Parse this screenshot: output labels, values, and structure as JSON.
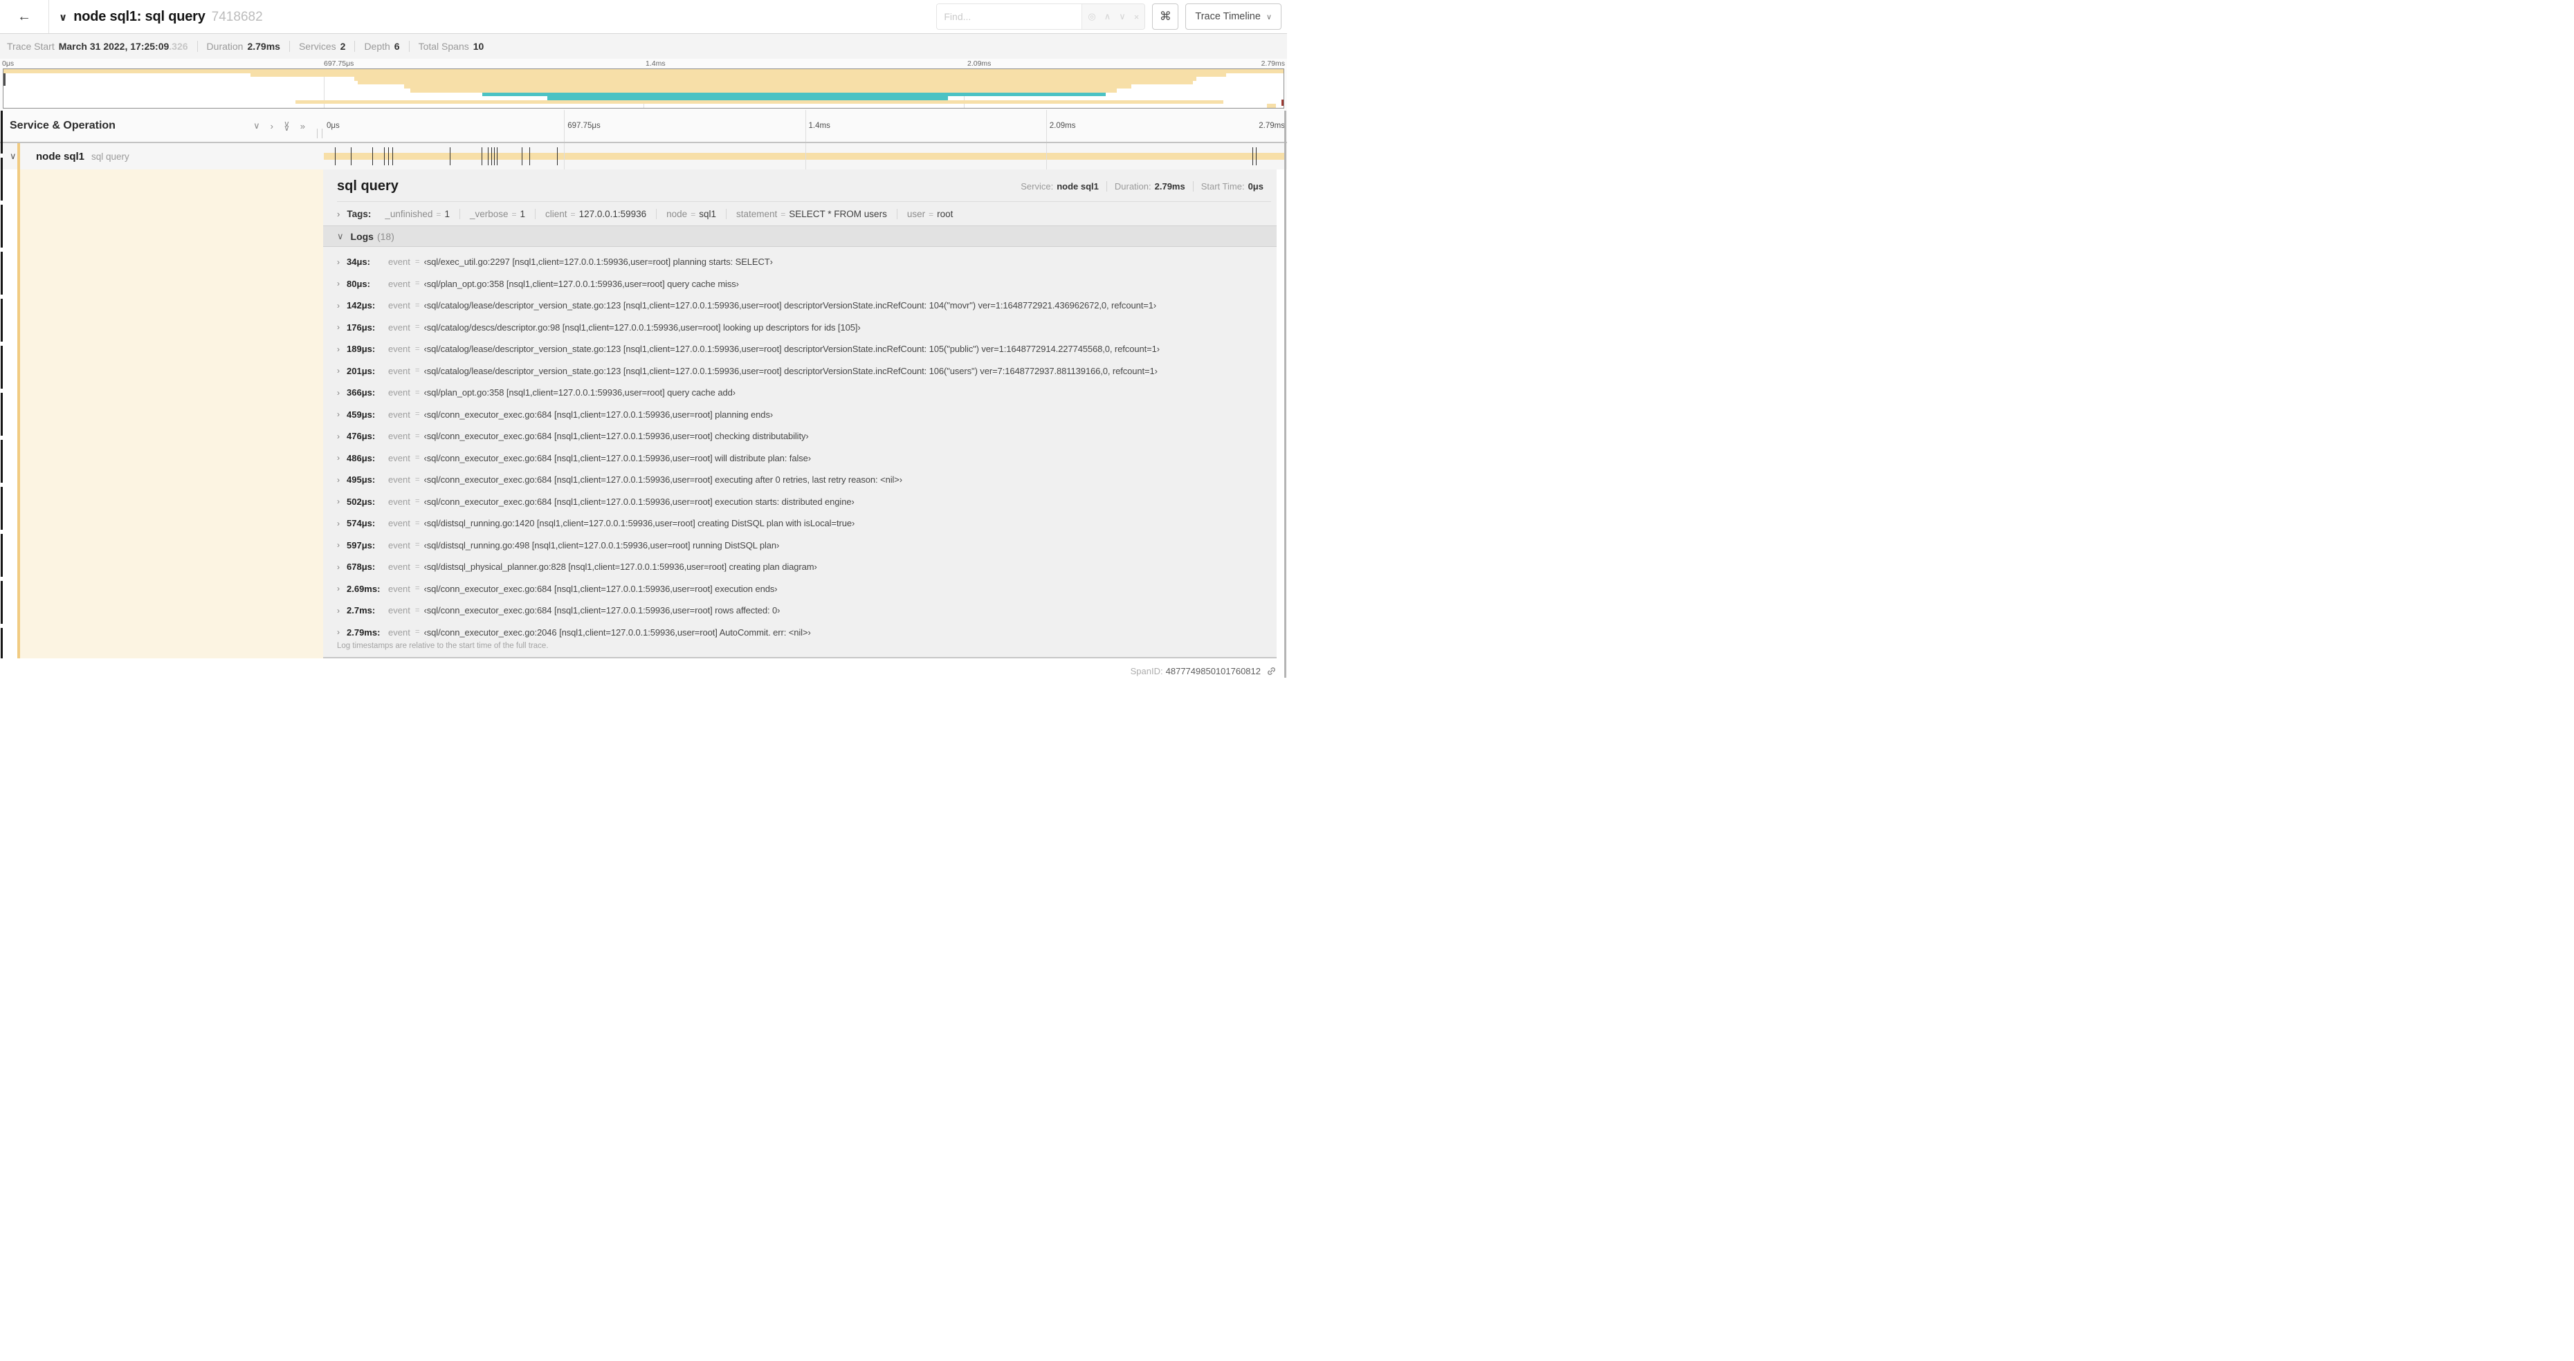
{
  "icons": {
    "back": "←",
    "chevron_down": "∨",
    "chevron_up": "∧",
    "chevron_right": "›",
    "double_chevron_right": "»",
    "close": "×",
    "command": "⌘",
    "crosshair": "◎"
  },
  "header": {
    "title": "node sql1: sql query",
    "trace_id": "7418682",
    "find_placeholder": "Find...",
    "view_dropdown_label": "Trace Timeline"
  },
  "trace_info": [
    {
      "label": "Trace Start",
      "value": "March 31 2022, 17:25:09",
      "suffix": ".326"
    },
    {
      "label": "Duration",
      "value": "2.79ms"
    },
    {
      "label": "Services",
      "value": "2"
    },
    {
      "label": "Depth",
      "value": "6"
    },
    {
      "label": "Total Spans",
      "value": "10"
    }
  ],
  "ruler": {
    "ticks": [
      {
        "label": "0μs",
        "pct": 0
      },
      {
        "label": "697.75μs",
        "pct": 25
      },
      {
        "label": "1.4ms",
        "pct": 50
      },
      {
        "label": "2.09ms",
        "pct": 75
      },
      {
        "label": "2.79ms",
        "pct": 100
      }
    ],
    "gridlines": [
      25,
      50,
      75
    ]
  },
  "colors": {
    "tan": "#f7dfa8",
    "cyan": "#4bc2c4",
    "stripe": "#f1cb82",
    "cream": "#fcf4e2"
  },
  "minimap": {
    "bars": [
      {
        "row": 0,
        "start": 0,
        "end": 100,
        "color": "tan"
      },
      {
        "row": 1,
        "start": 19.3,
        "end": 95.5,
        "color": "tan"
      },
      {
        "row": 2,
        "start": 27.4,
        "end": 93.2,
        "color": "tan"
      },
      {
        "row": 3,
        "start": 27.7,
        "end": 92.9,
        "color": "tan"
      },
      {
        "row": 4,
        "start": 31.3,
        "end": 88.1,
        "color": "tan"
      },
      {
        "row": 5,
        "start": 31.8,
        "end": 87.0,
        "color": "tan"
      },
      {
        "row": 6,
        "start": 37.4,
        "end": 86.1,
        "color": "cyan"
      },
      {
        "row": 7,
        "start": 42.5,
        "end": 73.8,
        "color": "cyan"
      },
      {
        "row": 8,
        "start": 22.8,
        "end": 95.3,
        "color": "tan"
      },
      {
        "row": 9,
        "start": 98.7,
        "end": 99.4,
        "color": "tan"
      }
    ]
  },
  "span_table": {
    "header_label": "Service & Operation",
    "row": {
      "service": "node sql1",
      "operation": "sql query"
    },
    "tick_pcts": [
      1.22,
      2.87,
      5.09,
      6.31,
      6.77,
      7.2,
      13.12,
      16.45,
      17.06,
      17.42,
      17.74,
      17.99,
      20.57,
      21.4,
      24.3,
      96.42,
      96.77,
      99.75
    ]
  },
  "detail": {
    "title": "sql query",
    "meta": [
      {
        "label": "Service:",
        "value": "node sql1"
      },
      {
        "label": "Duration:",
        "value": "2.79ms"
      },
      {
        "label": "Start Time:",
        "value": "0μs"
      }
    ],
    "tags_label": "Tags:",
    "tags": [
      {
        "key": "_unfinished",
        "value": "1"
      },
      {
        "key": "_verbose",
        "value": "1"
      },
      {
        "key": "client",
        "value": "127.0.0.1:59936"
      },
      {
        "key": "node",
        "value": "sql1"
      },
      {
        "key": "statement",
        "value": "SELECT * FROM users"
      },
      {
        "key": "user",
        "value": "root"
      }
    ],
    "logs": {
      "label": "Logs",
      "count": "(18)",
      "field": "event",
      "equals": "=",
      "entries": [
        {
          "time": "34μs:",
          "value": "‹sql/exec_util.go:2297 [nsql1,client=127.0.0.1:59936,user=root] planning starts: SELECT›"
        },
        {
          "time": "80μs:",
          "value": "‹sql/plan_opt.go:358 [nsql1,client=127.0.0.1:59936,user=root] query cache miss›"
        },
        {
          "time": "142μs:",
          "value": "‹sql/catalog/lease/descriptor_version_state.go:123 [nsql1,client=127.0.0.1:59936,user=root] descriptorVersionState.incRefCount: 104(\"movr\") ver=1:1648772921.436962672,0, refcount=1›"
        },
        {
          "time": "176μs:",
          "value": "‹sql/catalog/descs/descriptor.go:98 [nsql1,client=127.0.0.1:59936,user=root] looking up descriptors for ids [105]›"
        },
        {
          "time": "189μs:",
          "value": "‹sql/catalog/lease/descriptor_version_state.go:123 [nsql1,client=127.0.0.1:59936,user=root] descriptorVersionState.incRefCount: 105(\"public\") ver=1:1648772914.227745568,0, refcount=1›"
        },
        {
          "time": "201μs:",
          "value": "‹sql/catalog/lease/descriptor_version_state.go:123 [nsql1,client=127.0.0.1:59936,user=root] descriptorVersionState.incRefCount: 106(\"users\") ver=7:1648772937.881139166,0, refcount=1›"
        },
        {
          "time": "366μs:",
          "value": "‹sql/plan_opt.go:358 [nsql1,client=127.0.0.1:59936,user=root] query cache add›"
        },
        {
          "time": "459μs:",
          "value": "‹sql/conn_executor_exec.go:684 [nsql1,client=127.0.0.1:59936,user=root] planning ends›"
        },
        {
          "time": "476μs:",
          "value": "‹sql/conn_executor_exec.go:684 [nsql1,client=127.0.0.1:59936,user=root] checking distributability›"
        },
        {
          "time": "486μs:",
          "value": "‹sql/conn_executor_exec.go:684 [nsql1,client=127.0.0.1:59936,user=root] will distribute plan: false›"
        },
        {
          "time": "495μs:",
          "value": "‹sql/conn_executor_exec.go:684 [nsql1,client=127.0.0.1:59936,user=root] executing after 0 retries, last retry reason: <nil>›"
        },
        {
          "time": "502μs:",
          "value": "‹sql/conn_executor_exec.go:684 [nsql1,client=127.0.0.1:59936,user=root] execution starts: distributed engine›"
        },
        {
          "time": "574μs:",
          "value": "‹sql/distsql_running.go:1420 [nsql1,client=127.0.0.1:59936,user=root] creating DistSQL plan with isLocal=true›"
        },
        {
          "time": "597μs:",
          "value": "‹sql/distsql_running.go:498 [nsql1,client=127.0.0.1:59936,user=root] running DistSQL plan›"
        },
        {
          "time": "678μs:",
          "value": "‹sql/distsql_physical_planner.go:828 [nsql1,client=127.0.0.1:59936,user=root] creating plan diagram›"
        },
        {
          "time": "2.69ms:",
          "value": "‹sql/conn_executor_exec.go:684 [nsql1,client=127.0.0.1:59936,user=root] execution ends›"
        },
        {
          "time": "2.7ms:",
          "value": "‹sql/conn_executor_exec.go:684 [nsql1,client=127.0.0.1:59936,user=root] rows affected: 0›"
        },
        {
          "time": "2.79ms:",
          "value": "‹sql/conn_executor_exec.go:2046 [nsql1,client=127.0.0.1:59936,user=root] AutoCommit. err: <nil>›"
        }
      ]
    },
    "footer_note": "Log timestamps are relative to the start time of the full trace.",
    "spanid_label": "SpanID:",
    "spanid": "4877749850101760812"
  }
}
